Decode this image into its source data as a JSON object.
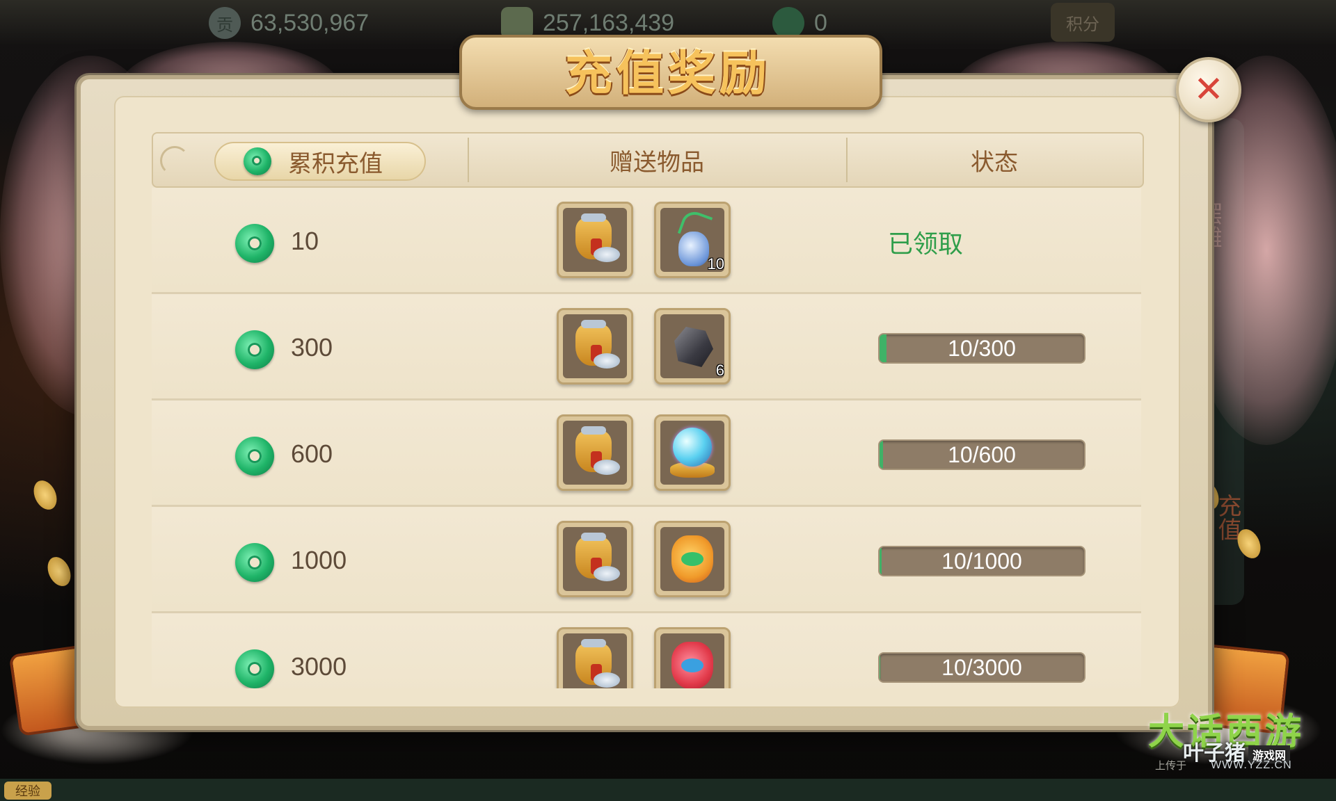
{
  "top_bar": {
    "resource1": {
      "icon": "tribute-coin-icon",
      "glyph": "贡",
      "value": "63,530,967"
    },
    "resource2": {
      "icon": "gold-ingot-icon",
      "value": "257,163,439"
    },
    "resource3": {
      "icon": "jade-currency-icon",
      "value": "0"
    },
    "score_button": "积分"
  },
  "side_labels": {
    "stall": "摆摊",
    "middle": "",
    "recharge": "充值"
  },
  "bottom_bar": {
    "exp_label": "经验"
  },
  "dialog": {
    "title": "充值奖励",
    "close_icon": "close-icon",
    "headers": {
      "cumulative_recharge": "累积充值",
      "gift_items": "赠送物品",
      "status": "状态"
    },
    "rows": [
      {
        "amount": "10",
        "items": [
          {
            "icon": "silver-money-bag-icon",
            "count": ""
          },
          {
            "icon": "jade-vase-icon",
            "count": "10"
          }
        ],
        "status_type": "claimed",
        "status_text": "已领取"
      },
      {
        "amount": "300",
        "items": [
          {
            "icon": "silver-money-bag-icon",
            "count": ""
          },
          {
            "icon": "black-ore-icon",
            "count": "6"
          }
        ],
        "status_type": "progress",
        "progress_text": "10/300",
        "progress_fraction": 0.0333
      },
      {
        "amount": "600",
        "items": [
          {
            "icon": "silver-money-bag-icon",
            "count": ""
          },
          {
            "icon": "crystal-orb-icon",
            "count": ""
          }
        ],
        "status_type": "progress",
        "progress_text": "10/600",
        "progress_fraction": 0.0167
      },
      {
        "amount": "1000",
        "items": [
          {
            "icon": "silver-money-bag-icon",
            "count": ""
          },
          {
            "icon": "golden-lucky-bag-icon",
            "count": ""
          }
        ],
        "status_type": "progress",
        "progress_text": "10/1000",
        "progress_fraction": 0.01
      },
      {
        "amount": "3000",
        "items": [
          {
            "icon": "silver-money-bag-icon",
            "count": ""
          },
          {
            "icon": "red-lucky-bag-icon",
            "count": ""
          }
        ],
        "status_type": "progress",
        "progress_text": "10/3000",
        "progress_fraction": 0.0033
      }
    ]
  },
  "watermark": {
    "site": "叶子猪",
    "badge": "游戏网",
    "url": "WWW.YZZ.CN",
    "upload": "上传于"
  },
  "logo_text": "大话西游",
  "colors": {
    "claimed_green": "#2f9e4a",
    "progress_bg": "#8e7c67",
    "progress_fill": "#3fb267",
    "title_gold": "#f6c25c"
  }
}
